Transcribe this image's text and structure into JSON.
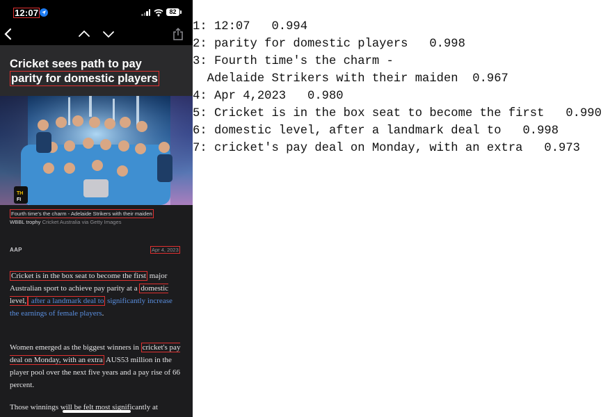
{
  "status_bar": {
    "time": "12:07",
    "battery": "82",
    "icons": [
      "location-arrow-icon",
      "signal-icon",
      "wifi-icon",
      "battery-icon"
    ]
  },
  "nav": {
    "icons": [
      "back-chevron-icon",
      "chevron-up-icon",
      "chevron-down-icon",
      "share-icon"
    ]
  },
  "article": {
    "headline_line1": "Cricket sees path to pay",
    "headline_line2": "parity for domestic players",
    "image_alt": "Adelaide Strikers celebrating with trophy",
    "caption_line1": "Fourth time's the charm - Adelaide Strikers with their maiden",
    "caption_trophy": "WBBL trophy",
    "caption_credit": "Cricket Australia via Getty Images",
    "source": "AAP",
    "date": "Apr 4, 2023",
    "para1_line1": "Cricket is in the box seat to become the first",
    "para1_mid": "major Australian sport to achieve pay parity at a",
    "para1_boxed": "domestic level,",
    "para1_link_boxed": " after a landmark deal to",
    "para1_link_rest": "significantly increase the earnings of female players",
    "para1_end": ".",
    "para2_start": "Women emerged as the biggest winners in",
    "para2_boxed": "cricket's pay deal on Monday, with an extra",
    "para2_rest": "AUS53 million in the player pool over the next five years and a pay rise of 66 percent.",
    "para3": "Those winnings will be felt most significantly at"
  },
  "ocr": {
    "lines": [
      "1: 12:07   0.994",
      "2: parity for domestic players   0.998",
      "3: Fourth time's the charm -",
      "  Adelaide Strikers with their maiden  0.967",
      "4: Apr 4,2023   0.980",
      "5: Cricket is in the box seat to become the first   0.990",
      "6: domestic level, after a landmark deal to   0.998",
      "7: cricket's pay deal on Monday, with an extra   0.973"
    ]
  },
  "colors": {
    "box_outline": "#e03030",
    "link": "#5a8fe0",
    "location_icon": "#1e7cf2",
    "phone_bg": "#1c1c1e"
  }
}
